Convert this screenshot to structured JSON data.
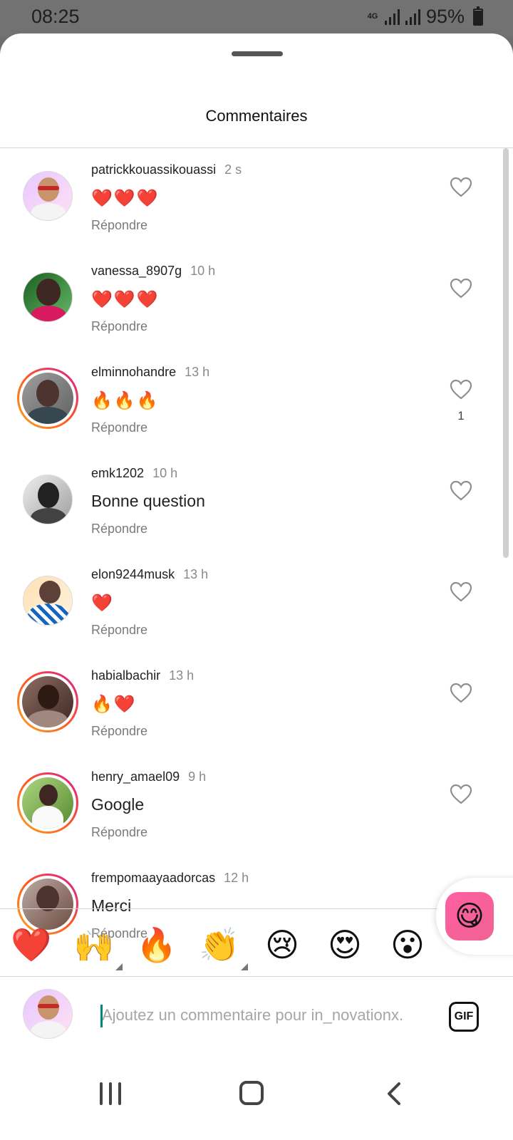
{
  "status_bar": {
    "time": "08:25",
    "network": "4G",
    "battery": "95%",
    "battery_level": 0.95
  },
  "sheet": {
    "title": "Commentaires"
  },
  "comments": [
    {
      "user": "patrickkouassikouassi",
      "time": "2 s",
      "text": "❤️❤️❤️",
      "reply_label": "Répondre",
      "likes": ""
    },
    {
      "user": "vanessa_8907g",
      "time": "10 h",
      "text": "❤️❤️❤️",
      "reply_label": "Répondre",
      "likes": ""
    },
    {
      "user": "elminnohandre",
      "time": "13 h",
      "text": "🔥🔥🔥",
      "reply_label": "Répondre",
      "likes": "1"
    },
    {
      "user": "emk1202",
      "time": "10 h",
      "text": "Bonne question",
      "reply_label": "Répondre",
      "likes": ""
    },
    {
      "user": "elon9244musk",
      "time": "13 h",
      "text": "❤️",
      "reply_label": "Répondre",
      "likes": ""
    },
    {
      "user": "habialbachir",
      "time": "13 h",
      "text": "🔥❤️",
      "reply_label": "Répondre",
      "likes": ""
    },
    {
      "user": "henry_amael09",
      "time": "9 h",
      "text": "Google",
      "reply_label": "Répondre",
      "likes": ""
    },
    {
      "user": "frempomaayaadorcas",
      "time": "12 h",
      "text": "Merci",
      "reply_label": "Répondre",
      "likes": ""
    }
  ],
  "reactions": [
    "❤️",
    "🙌",
    "🔥",
    "👏",
    "😢",
    "😍",
    "😮"
  ],
  "composer": {
    "placeholder": "Ajoutez un commentaire pour in_novationx.",
    "gif_label": "GIF"
  },
  "icons": {
    "like": "heart-outline-icon",
    "sticker": "sticker-icon",
    "nav_recents": "recents-icon",
    "nav_home": "home-icon",
    "nav_back": "back-icon"
  }
}
